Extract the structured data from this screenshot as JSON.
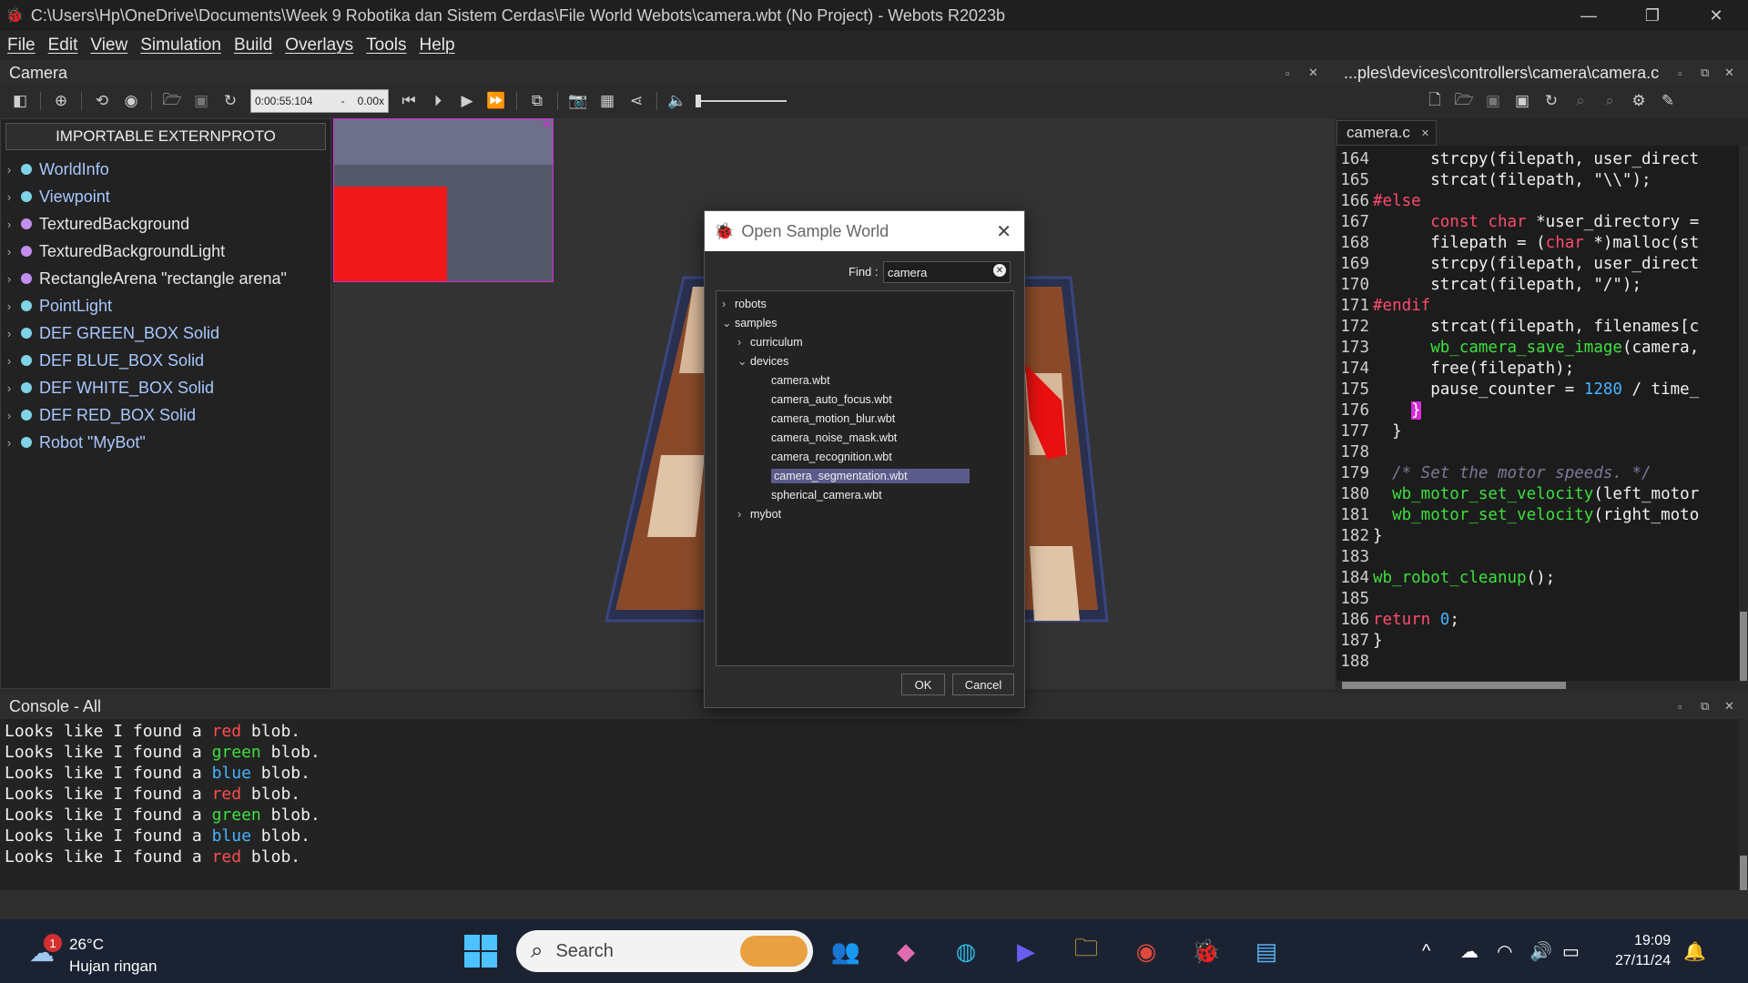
{
  "window": {
    "title": "C:\\Users\\Hp\\OneDrive\\Documents\\Week 9 Robotika dan Sistem Cerdas\\File World Webots\\camera.wbt (No Project) - Webots R2023b",
    "minimize": "—",
    "maximize": "❐",
    "close": "✕"
  },
  "menu": [
    "File",
    "Edit",
    "View",
    "Simulation",
    "Build",
    "Overlays",
    "Tools",
    "Help"
  ],
  "left_panel": {
    "title": "Camera",
    "time": "0:00:55:104",
    "speed": "0.00x",
    "importable": "IMPORTABLE EXTERNPROTO",
    "tree": [
      {
        "label": "WorldInfo",
        "color": "#a8c8ff",
        "dot": "#7fd3e6"
      },
      {
        "label": "Viewpoint",
        "color": "#a8c8ff",
        "dot": "#7fd3e6"
      },
      {
        "label": "TexturedBackground",
        "color": "#e6e6e6",
        "dot": "#c48ef0"
      },
      {
        "label": "TexturedBackgroundLight",
        "color": "#e6e6e6",
        "dot": "#c48ef0"
      },
      {
        "label": "RectangleArena \"rectangle arena\"",
        "color": "#e6e6e6",
        "dot": "#c48ef0"
      },
      {
        "label": "PointLight",
        "color": "#a8c8ff",
        "dot": "#7fd3e6"
      },
      {
        "label": "DEF GREEN_BOX Solid",
        "color": "#a8c8ff",
        "dot": "#7fd3e6"
      },
      {
        "label": "DEF BLUE_BOX Solid",
        "color": "#a8c8ff",
        "dot": "#7fd3e6"
      },
      {
        "label": "DEF WHITE_BOX Solid",
        "color": "#a8c8ff",
        "dot": "#7fd3e6"
      },
      {
        "label": "DEF RED_BOX Solid",
        "color": "#a8c8ff",
        "dot": "#7fd3e6"
      },
      {
        "label": "Robot \"MyBot\"",
        "color": "#a8c8ff",
        "dot": "#7fd3e6"
      }
    ]
  },
  "editor": {
    "path": "...ples\\devices\\controllers\\camera\\camera.c",
    "tab": "camera.c",
    "tab_close": "✕",
    "lines": [
      {
        "n": "164",
        "code": [
          {
            "t": "      strcpy(filepath, user_direct",
            "c": "#f0f0f0"
          }
        ]
      },
      {
        "n": "165",
        "code": [
          {
            "t": "      strcat(filepath, \"\\\\\");",
            "c": "#f0f0f0"
          }
        ]
      },
      {
        "n": "166",
        "code": [
          {
            "t": "#else",
            "c": "#ff4b6e"
          }
        ]
      },
      {
        "n": "167",
        "code": [
          {
            "t": "      ",
            "c": "#f0f0f0"
          },
          {
            "t": "const char",
            "c": "#ff4b6e"
          },
          {
            "t": " *user_directory =",
            "c": "#f0f0f0"
          }
        ]
      },
      {
        "n": "168",
        "code": [
          {
            "t": "      filepath = (",
            "c": "#f0f0f0"
          },
          {
            "t": "char",
            "c": "#ff4b6e"
          },
          {
            "t": " *)malloc(st",
            "c": "#f0f0f0"
          }
        ]
      },
      {
        "n": "169",
        "code": [
          {
            "t": "      strcpy(filepath, user_direct",
            "c": "#f0f0f0"
          }
        ]
      },
      {
        "n": "170",
        "code": [
          {
            "t": "      strcat(filepath, \"/\");",
            "c": "#f0f0f0"
          }
        ]
      },
      {
        "n": "171",
        "code": [
          {
            "t": "#endif",
            "c": "#ff4b6e"
          }
        ]
      },
      {
        "n": "172",
        "code": [
          {
            "t": "      strcat(filepath, filenames[c",
            "c": "#f0f0f0"
          }
        ]
      },
      {
        "n": "173",
        "code": [
          {
            "t": "      ",
            "c": "#f0f0f0"
          },
          {
            "t": "wb_camera_save_image",
            "c": "#3ee03e"
          },
          {
            "t": "(camera,",
            "c": "#f0f0f0"
          }
        ]
      },
      {
        "n": "174",
        "code": [
          {
            "t": "      free(filepath);",
            "c": "#f0f0f0"
          }
        ]
      },
      {
        "n": "175",
        "code": [
          {
            "t": "      pause_counter = ",
            "c": "#f0f0f0"
          },
          {
            "t": "1280",
            "c": "#46b4ff"
          },
          {
            "t": " / time_",
            "c": "#f0f0f0"
          }
        ]
      },
      {
        "n": "176",
        "code": [
          {
            "t": "    ",
            "c": "#f0f0f0"
          },
          {
            "t": "}",
            "c": "#ffffff",
            "bg": "#d62bd6"
          }
        ]
      },
      {
        "n": "177",
        "code": [
          {
            "t": "  }",
            "c": "#f0f0f0"
          }
        ]
      },
      {
        "n": "178",
        "code": [
          {
            "t": "",
            "c": "#f0f0f0"
          }
        ]
      },
      {
        "n": "179",
        "code": [
          {
            "t": "  /* Set the motor speeds. */",
            "c": "#7a7a9a",
            "i": true
          }
        ]
      },
      {
        "n": "180",
        "code": [
          {
            "t": "  ",
            "c": "#f0f0f0"
          },
          {
            "t": "wb_motor_set_velocity",
            "c": "#3ee03e"
          },
          {
            "t": "(left_motor",
            "c": "#f0f0f0"
          }
        ]
      },
      {
        "n": "181",
        "code": [
          {
            "t": "  ",
            "c": "#f0f0f0"
          },
          {
            "t": "wb_motor_set_velocity",
            "c": "#3ee03e"
          },
          {
            "t": "(right_moto",
            "c": "#f0f0f0"
          }
        ]
      },
      {
        "n": "182",
        "code": [
          {
            "t": "}",
            "c": "#f0f0f0"
          }
        ]
      },
      {
        "n": "183",
        "code": [
          {
            "t": "",
            "c": "#f0f0f0"
          }
        ]
      },
      {
        "n": "184",
        "code": [
          {
            "t": "wb_robot_cleanup",
            "c": "#3ee03e"
          },
          {
            "t": "();",
            "c": "#f0f0f0"
          }
        ]
      },
      {
        "n": "185",
        "code": [
          {
            "t": "",
            "c": "#f0f0f0"
          }
        ]
      },
      {
        "n": "186",
        "code": [
          {
            "t": "return",
            "c": "#ff4b6e"
          },
          {
            "t": " ",
            "c": "#f0f0f0"
          },
          {
            "t": "0",
            "c": "#46b4ff"
          },
          {
            "t": ";",
            "c": "#f0f0f0"
          }
        ]
      },
      {
        "n": "187",
        "code": [
          {
            "t": "}",
            "c": "#f0f0f0"
          }
        ]
      },
      {
        "n": "188",
        "code": [
          {
            "t": "",
            "c": "#f0f0f0"
          }
        ]
      }
    ]
  },
  "console": {
    "title": "Console - All",
    "lines": [
      {
        "word": "red",
        "color": "#ff4d4d"
      },
      {
        "word": "green",
        "color": "#3ee03e"
      },
      {
        "word": "blue",
        "color": "#46b4ff"
      },
      {
        "word": "red",
        "color": "#ff4d4d"
      },
      {
        "word": "green",
        "color": "#3ee03e"
      },
      {
        "word": "blue",
        "color": "#46b4ff"
      },
      {
        "word": "red",
        "color": "#ff4d4d"
      }
    ],
    "prefix": "Looks like I found a ",
    "suffix": " blob."
  },
  "dialog": {
    "title": "Open Sample World",
    "close": "✕",
    "find_label": "Find :",
    "find_value": "camera",
    "ok": "OK",
    "cancel": "Cancel",
    "tree": [
      {
        "label": "robots",
        "arrow": "›",
        "indent": 0
      },
      {
        "label": "samples",
        "arrow": "⌄",
        "indent": 0
      },
      {
        "label": "curriculum",
        "arrow": "›",
        "indent": 1
      },
      {
        "label": "devices",
        "arrow": "⌄",
        "indent": 1
      },
      {
        "label": "camera.wbt",
        "arrow": "",
        "indent": 2
      },
      {
        "label": "camera_auto_focus.wbt",
        "arrow": "",
        "indent": 2
      },
      {
        "label": "camera_motion_blur.wbt",
        "arrow": "",
        "indent": 2
      },
      {
        "label": "camera_noise_mask.wbt",
        "arrow": "",
        "indent": 2
      },
      {
        "label": "camera_recognition.wbt",
        "arrow": "",
        "indent": 2
      },
      {
        "label": "camera_segmentation.wbt",
        "arrow": "",
        "indent": 2,
        "selected": true
      },
      {
        "label": "spherical_camera.wbt",
        "arrow": "",
        "indent": 2
      },
      {
        "label": "mybot",
        "arrow": "›",
        "indent": 1
      }
    ]
  },
  "taskbar": {
    "weather_temp": "26°C",
    "weather_desc": "Hujan ringan",
    "weather_badge": "1",
    "search": "Search",
    "time": "19:09",
    "date": "27/11/24"
  }
}
